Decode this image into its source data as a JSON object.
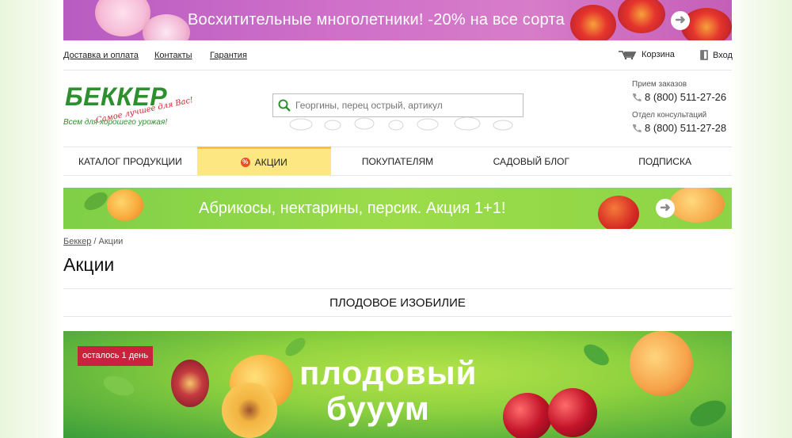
{
  "top_banner": {
    "text": "Восхитительные многолетники! -20% на все сорта"
  },
  "util": {
    "links": [
      "Доставка и оплата",
      "Контакты",
      "Гарантия"
    ],
    "cart": "Корзина",
    "login": "Вход"
  },
  "logo": {
    "brand": "БЕККЕР",
    "slogan": "Самое лучшее для Вас!",
    "sub": "Всем для хорошего урожая!"
  },
  "search": {
    "placeholder": "Георгины, перец острый, артикул"
  },
  "phones": {
    "orders_label": "Прием заказов",
    "orders_number": "8 (800) 511-27-26",
    "consult_label": "Отдел консультаций",
    "consult_number": "8 (800) 511-27-28"
  },
  "nav": {
    "items": [
      "Каталог продукции",
      "Акции",
      "Покупателям",
      "Садовый блог",
      "Подписка"
    ],
    "sale_icon": "%"
  },
  "promo_banner": {
    "text": "Абрикосы, нектарины, персик. Акция 1+1!"
  },
  "breadcrumb": {
    "home": "Беккер",
    "sep": " / ",
    "current": "Акции"
  },
  "page_title": "Акции",
  "section_title": "ПЛОДОВОЕ ИЗОБИЛИЕ",
  "big_banner": {
    "badge": "осталось 1 день",
    "line1": "плодовый",
    "line2": "бууум"
  },
  "colors": {
    "brand_green": "#2e8f2e",
    "nav_active": "#fde782",
    "badge": "#c7233c"
  }
}
